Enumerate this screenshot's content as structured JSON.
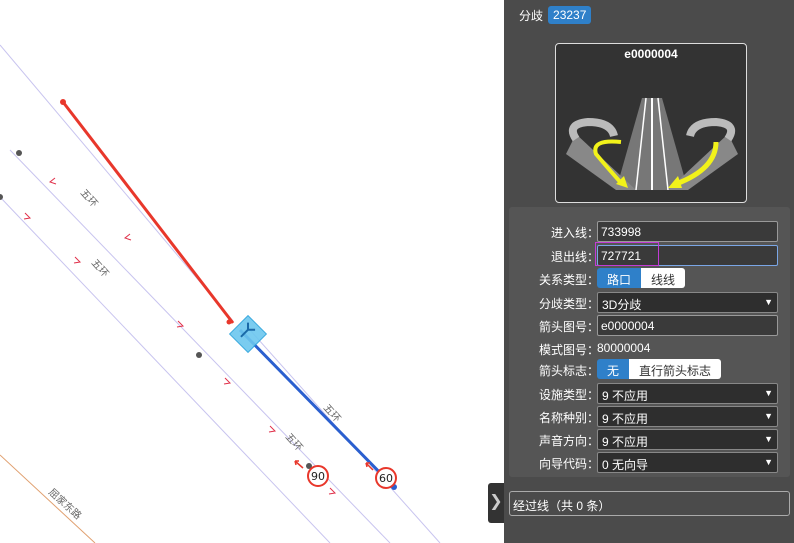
{
  "header": {
    "label": "分歧",
    "badge": "23237"
  },
  "preview": {
    "code": "e0000004"
  },
  "form": {
    "entry_line": {
      "label": "进入线：",
      "value": "733998"
    },
    "exit_line": {
      "label": "退出线：",
      "value": "727721"
    },
    "relation_type": {
      "label": "关系类型：",
      "options": [
        "路口",
        "线线"
      ],
      "selected": "路口"
    },
    "branch_type": {
      "label": "分歧类型：",
      "value": "3D分歧"
    },
    "arrow_code": {
      "label": "箭头图号：",
      "value": "e0000004"
    },
    "pattern_code": {
      "label": "模式图号：",
      "value": "80000004"
    },
    "arrow_flag": {
      "label": "箭头标志：",
      "options": [
        "无",
        "直行箭头标志"
      ],
      "selected": "无"
    },
    "facility_type": {
      "label": "设施类型：",
      "value": "9 不应用"
    },
    "name_kind": {
      "label": "名称种别：",
      "value": "9 不应用"
    },
    "sound_direction": {
      "label": "声音方向：",
      "value": "9 不应用"
    },
    "guide_code": {
      "label": "向导代码：",
      "value": "0 无向导"
    }
  },
  "pass_lines": {
    "label": "经过线（共 0 条）"
  },
  "map": {
    "road_labels": [
      "五环",
      "五环",
      "五环",
      "五环",
      "屈家东路"
    ],
    "speed_limits": [
      "90",
      "60"
    ]
  },
  "colors": {
    "accent": "#2f80c9",
    "entry_line": "#e8372b",
    "exit_line": "#2b5fcf",
    "panel_bg": "#4b4b4b"
  },
  "icons": [
    "dropdown-arrow-icon",
    "chevron-right-icon",
    "branch-sign-icon"
  ]
}
